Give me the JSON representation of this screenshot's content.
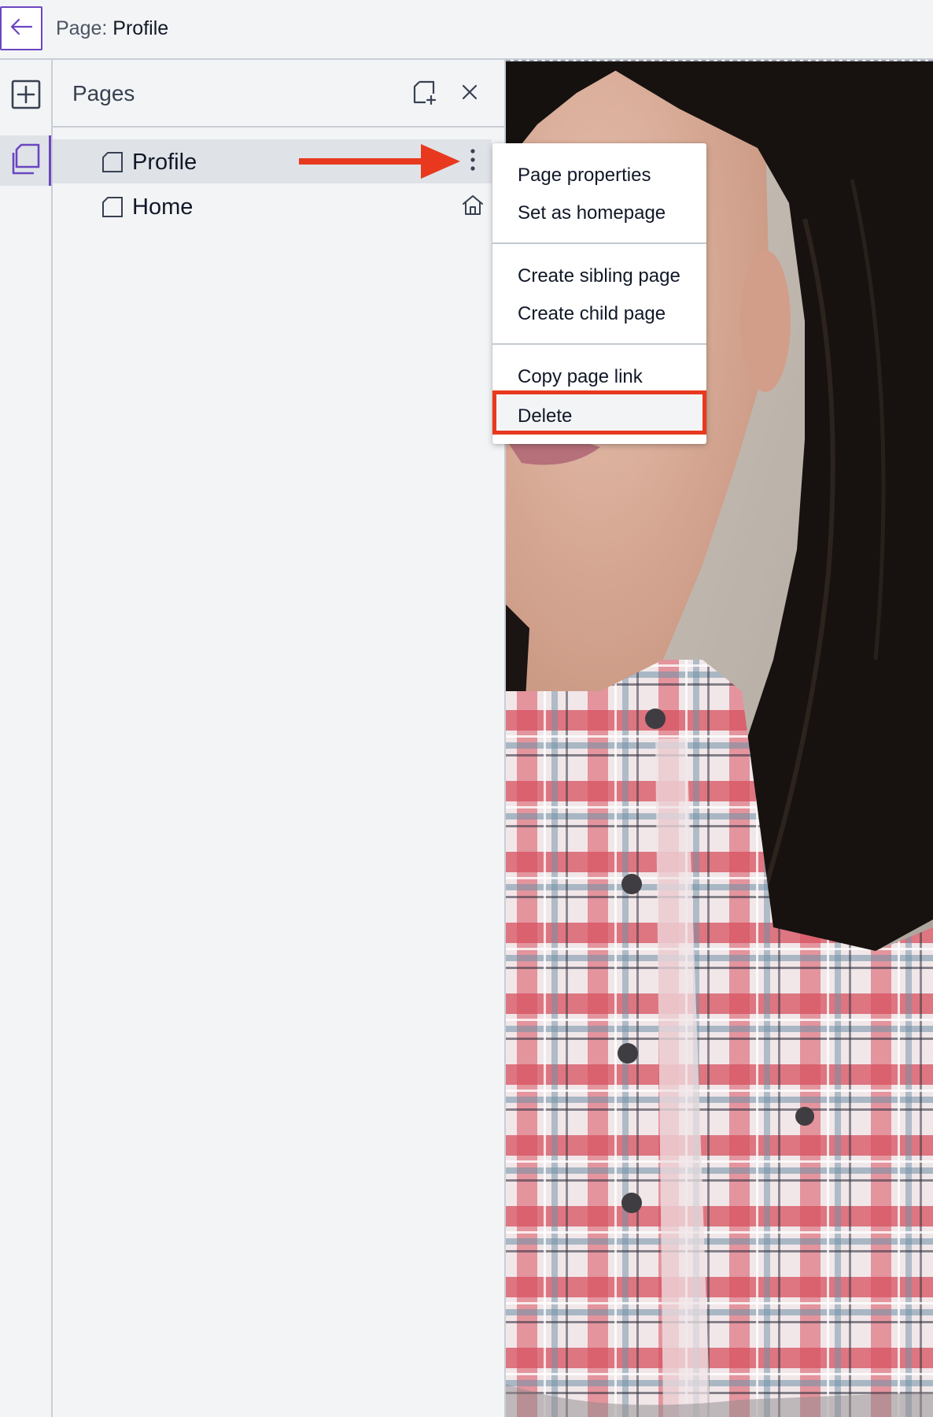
{
  "header": {
    "page_prefix": "Page:",
    "page_name": "Profile"
  },
  "panel": {
    "title": "Pages",
    "pages": [
      {
        "label": "Profile",
        "selected": true
      },
      {
        "label": "Home",
        "is_homepage": true
      }
    ]
  },
  "context_menu": {
    "items": [
      "Page properties",
      "Set as homepage",
      "Create sibling page",
      "Create child page",
      "Copy page link",
      "Delete"
    ],
    "highlighted_item": "Delete"
  },
  "icons": {
    "back": "arrow-left-icon",
    "add_element": "plus-square-icon",
    "pages": "pages-stack-icon",
    "add_page": "add-page-icon",
    "close": "close-icon",
    "page": "page-icon",
    "more": "more-vertical-icon",
    "home": "home-icon"
  },
  "colors": {
    "accent": "#6b46c1",
    "annotation": "#e8391e",
    "panel_bg": "#f3f4f6",
    "selected_row": "#dfe3e8"
  }
}
